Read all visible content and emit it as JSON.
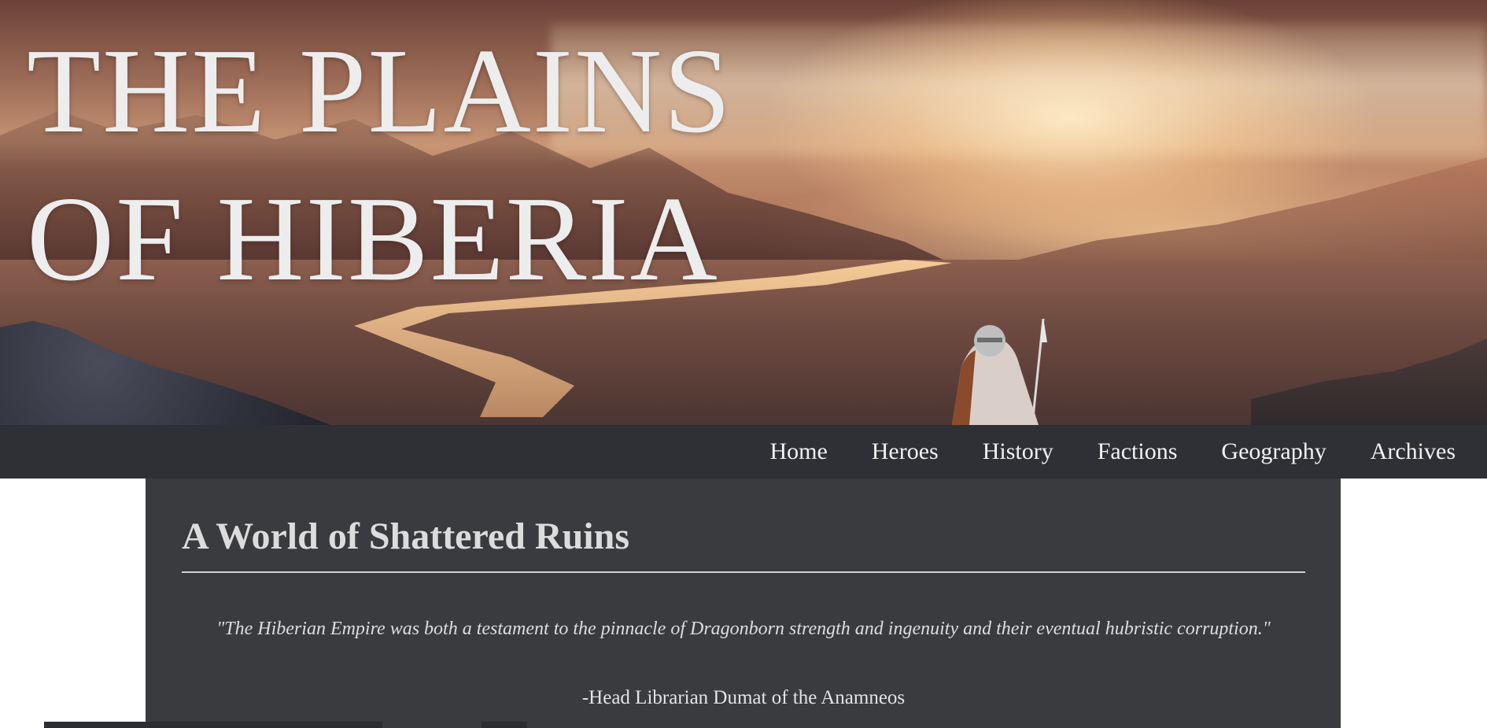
{
  "site": {
    "title_line1": "THE PLAINS",
    "title_line2": "OF HIBERIA"
  },
  "nav": {
    "items": [
      {
        "label": "Home"
      },
      {
        "label": "Heroes"
      },
      {
        "label": "History"
      },
      {
        "label": "Factions"
      },
      {
        "label": "Geography"
      },
      {
        "label": "Archives"
      }
    ]
  },
  "main": {
    "heading": "A World of Shattered Ruins",
    "quote": "\"The Hiberian Empire was both a testament to the pinnacle of Dragonborn strength and ingenuity and their eventual hubristic corruption.\"",
    "attribution": "-Head Librarian Dumat of the Anamneos"
  },
  "colors": {
    "navbar_bg": "#2e3035",
    "content_bg": "#3a3b3f",
    "title_text": "#ededed",
    "heading_text": "#dcdcdc"
  }
}
